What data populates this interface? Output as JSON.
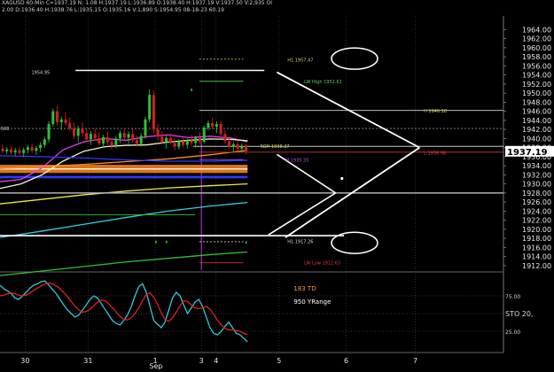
{
  "header": {
    "line1": "XAGUSD 60-Min  C=1937.19  N: 1.08  H:1937.19  L:1936.89  O:1938.40  H:1937.19  V:1937.50  V:2,935  OI",
    "line2": "2.00  D:1936.40  H:1938.76  L:1935.15  O:1935.16  V:1,890  S:1954.95  08-18-23 60.19"
  },
  "colors": {
    "background": "#000000",
    "price_box": "#ffffff",
    "up_candle": "#2fbf2f",
    "down_candle": "#d02020",
    "ma_magenta": "#e83cf0",
    "ma_white": "#f2f2d0",
    "ma_blue": "#2a3cff",
    "ma_orange": "#ff8a1c",
    "ma_yellow": "#f0e640",
    "ma_cyan": "#30d0e0",
    "ma_green": "#30c030",
    "stoch_cyan": "#30c8e0",
    "stoch_red": "#e02020"
  },
  "chart_data": [
    {
      "type": "candlestick",
      "yticks": [
        1912,
        1914,
        1916,
        1918,
        1920,
        1922,
        1924,
        1926,
        1928,
        1930,
        1932,
        1934,
        1936,
        1938,
        1940,
        1942,
        1944,
        1946,
        1948,
        1950,
        1952,
        1954,
        1956,
        1958,
        1960,
        1962,
        1964
      ],
      "ylim": [
        1911,
        1967
      ],
      "xlim": [
        0,
        120
      ],
      "date_labels": [
        {
          "label": "30",
          "x": 6
        },
        {
          "label": "31",
          "x": 21
        },
        {
          "label": "1",
          "x": 37
        },
        {
          "label": "Sep",
          "x": 37.2
        },
        {
          "label": "3",
          "x": 48
        },
        {
          "label": "4",
          "x": 51.5
        },
        {
          "label": "5",
          "x": 66.5
        },
        {
          "label": "6",
          "x": 82.5
        },
        {
          "label": "7",
          "x": 99
        }
      ],
      "current_price": "1937.19",
      "price_labels": [
        {
          "text": "1954.95",
          "x": 7.5,
          "y": 1954.6,
          "color": "#d8d8d8"
        },
        {
          "text": "500",
          "x": 0.2,
          "y": 1942.2,
          "color": "#d8d8d8"
        },
        {
          "text": "H1  1957.47",
          "x": 68.5,
          "y": 1957.3,
          "color": "#d8d060"
        },
        {
          "text": "LW High  1952.61",
          "x": 72.5,
          "y": 1952.6,
          "color": "#60d060"
        },
        {
          "text": "H  1946.18",
          "x": 101,
          "y": 1946.1,
          "color": "#d8d060"
        },
        {
          "text": "ROR  1938.27",
          "x": 62,
          "y": 1938.3,
          "color": "#d8d060"
        },
        {
          "text": "L  1936.98",
          "x": 101,
          "y": 1936.9,
          "color": "#e04040"
        },
        {
          "text": "M  1935.35",
          "x": 68,
          "y": 1935.3,
          "color": "#c050e0"
        },
        {
          "text": "H1  1917.26",
          "x": 68.5,
          "y": 1917.3,
          "color": "#d8d8d8"
        },
        {
          "text": "LW Low  1912.63",
          "x": 72.5,
          "y": 1912.7,
          "color": "#e04040"
        }
      ],
      "candles": [
        {
          "o": 1937.8,
          "h": 1938.6,
          "l": 1936.9,
          "c": 1937.2
        },
        {
          "o": 1937.2,
          "h": 1938.1,
          "l": 1936.6,
          "c": 1937.6
        },
        {
          "o": 1937.6,
          "h": 1938.4,
          "l": 1936.5,
          "c": 1936.9
        },
        {
          "o": 1936.9,
          "h": 1937.9,
          "l": 1936.2,
          "c": 1937.4
        },
        {
          "o": 1937.4,
          "h": 1938.2,
          "l": 1936.4,
          "c": 1936.8
        },
        {
          "o": 1936.8,
          "h": 1938.0,
          "l": 1935.9,
          "c": 1937.5
        },
        {
          "o": 1937.5,
          "h": 1938.6,
          "l": 1936.7,
          "c": 1938.1
        },
        {
          "o": 1938.1,
          "h": 1938.9,
          "l": 1936.8,
          "c": 1937.3
        },
        {
          "o": 1937.3,
          "h": 1938.4,
          "l": 1936.4,
          "c": 1937.9
        },
        {
          "o": 1937.9,
          "h": 1939.2,
          "l": 1937.0,
          "c": 1938.6
        },
        {
          "o": 1938.6,
          "h": 1940.4,
          "l": 1937.9,
          "c": 1939.8
        },
        {
          "o": 1939.8,
          "h": 1943.8,
          "l": 1939.1,
          "c": 1943.2
        },
        {
          "o": 1943.2,
          "h": 1946.6,
          "l": 1942.6,
          "c": 1946.0
        },
        {
          "o": 1946.0,
          "h": 1947.2,
          "l": 1942.8,
          "c": 1943.6
        },
        {
          "o": 1943.6,
          "h": 1944.8,
          "l": 1941.9,
          "c": 1944.2
        },
        {
          "o": 1944.2,
          "h": 1945.8,
          "l": 1942.9,
          "c": 1943.4
        },
        {
          "o": 1943.4,
          "h": 1944.6,
          "l": 1941.6,
          "c": 1942.2
        },
        {
          "o": 1942.2,
          "h": 1943.4,
          "l": 1939.9,
          "c": 1940.6
        },
        {
          "o": 1940.6,
          "h": 1942.8,
          "l": 1939.2,
          "c": 1942.2
        },
        {
          "o": 1942.2,
          "h": 1943.6,
          "l": 1940.4,
          "c": 1941.2
        },
        {
          "o": 1941.2,
          "h": 1942.4,
          "l": 1939.1,
          "c": 1939.8
        },
        {
          "o": 1939.8,
          "h": 1941.6,
          "l": 1938.6,
          "c": 1941.0
        },
        {
          "o": 1941.0,
          "h": 1942.2,
          "l": 1939.6,
          "c": 1940.1
        },
        {
          "o": 1940.1,
          "h": 1941.4,
          "l": 1938.4,
          "c": 1938.9
        },
        {
          "o": 1938.9,
          "h": 1940.8,
          "l": 1937.9,
          "c": 1940.3
        },
        {
          "o": 1940.3,
          "h": 1941.5,
          "l": 1938.6,
          "c": 1939.2
        },
        {
          "o": 1939.2,
          "h": 1940.1,
          "l": 1937.6,
          "c": 1938.4
        },
        {
          "o": 1938.4,
          "h": 1940.6,
          "l": 1937.9,
          "c": 1940.0
        },
        {
          "o": 1940.0,
          "h": 1941.8,
          "l": 1939.0,
          "c": 1941.2
        },
        {
          "o": 1941.2,
          "h": 1942.3,
          "l": 1939.6,
          "c": 1940.2
        },
        {
          "o": 1940.2,
          "h": 1941.6,
          "l": 1938.8,
          "c": 1941.0
        },
        {
          "o": 1941.0,
          "h": 1942.1,
          "l": 1939.1,
          "c": 1939.6
        },
        {
          "o": 1939.6,
          "h": 1940.6,
          "l": 1938.2,
          "c": 1938.8
        },
        {
          "o": 1938.8,
          "h": 1941.2,
          "l": 1938.2,
          "c": 1940.6
        },
        {
          "o": 1940.6,
          "h": 1944.8,
          "l": 1940.0,
          "c": 1944.2
        },
        {
          "o": 1944.2,
          "h": 1950.8,
          "l": 1943.6,
          "c": 1949.6
        },
        {
          "o": 1949.6,
          "h": 1950.6,
          "l": 1941.2,
          "c": 1942.0
        },
        {
          "o": 1942.0,
          "h": 1943.2,
          "l": 1939.6,
          "c": 1940.4
        },
        {
          "o": 1940.4,
          "h": 1941.6,
          "l": 1938.8,
          "c": 1939.2
        },
        {
          "o": 1939.2,
          "h": 1940.6,
          "l": 1937.8,
          "c": 1940.1
        },
        {
          "o": 1940.1,
          "h": 1941.2,
          "l": 1938.6,
          "c": 1939.0
        },
        {
          "o": 1939.0,
          "h": 1940.3,
          "l": 1937.4,
          "c": 1938.2
        },
        {
          "o": 1938.2,
          "h": 1939.8,
          "l": 1937.6,
          "c": 1939.4
        },
        {
          "o": 1939.4,
          "h": 1940.4,
          "l": 1938.1,
          "c": 1938.6
        },
        {
          "o": 1938.6,
          "h": 1940.0,
          "l": 1937.8,
          "c": 1939.6
        },
        {
          "o": 1939.6,
          "h": 1940.8,
          "l": 1938.4,
          "c": 1939.0
        },
        {
          "o": 1939.0,
          "h": 1940.6,
          "l": 1938.0,
          "c": 1940.2
        },
        {
          "o": 1940.2,
          "h": 1941.4,
          "l": 1938.8,
          "c": 1939.3
        },
        {
          "o": 1939.3,
          "h": 1942.8,
          "l": 1938.9,
          "c": 1942.4
        },
        {
          "o": 1942.4,
          "h": 1944.0,
          "l": 1941.8,
          "c": 1943.4
        },
        {
          "o": 1943.4,
          "h": 1944.6,
          "l": 1942.0,
          "c": 1942.6
        },
        {
          "o": 1942.6,
          "h": 1943.8,
          "l": 1941.2,
          "c": 1943.2
        },
        {
          "o": 1943.2,
          "h": 1943.9,
          "l": 1940.6,
          "c": 1941.0
        },
        {
          "o": 1941.0,
          "h": 1941.8,
          "l": 1938.8,
          "c": 1939.4
        },
        {
          "o": 1939.4,
          "h": 1940.4,
          "l": 1937.8,
          "c": 1938.2
        },
        {
          "o": 1938.2,
          "h": 1939.2,
          "l": 1937.0,
          "c": 1938.7
        },
        {
          "o": 1938.7,
          "h": 1939.4,
          "l": 1937.3,
          "c": 1937.8
        },
        {
          "o": 1937.8,
          "h": 1938.9,
          "l": 1937.0,
          "c": 1938.3
        },
        {
          "o": 1938.3,
          "h": 1938.8,
          "l": 1936.6,
          "c": 1937.2
        }
      ],
      "moving_averages": [
        {
          "color": "ma_magenta",
          "points": [
            [
              0,
              1930.5
            ],
            [
              5,
              1931
            ],
            [
              10,
              1933.5
            ],
            [
              15,
              1937.5
            ],
            [
              20,
              1939.3
            ],
            [
              25,
              1940
            ],
            [
              30,
              1939.6
            ],
            [
              35,
              1940.4
            ],
            [
              40,
              1940.8
            ],
            [
              45,
              1940.2
            ],
            [
              50,
              1940.5
            ],
            [
              55,
              1940.1
            ],
            [
              59,
              1939.3
            ]
          ]
        },
        {
          "color": "ma_white",
          "points": [
            [
              0,
              1929
            ],
            [
              5,
              1930
            ],
            [
              10,
              1932
            ],
            [
              15,
              1935
            ],
            [
              20,
              1937.2
            ],
            [
              25,
              1938.2
            ],
            [
              30,
              1938.5
            ],
            [
              35,
              1938.6
            ],
            [
              40,
              1939.2
            ],
            [
              45,
              1939.6
            ],
            [
              50,
              1939.9
            ],
            [
              55,
              1939.8
            ],
            [
              59,
              1939.5
            ]
          ]
        },
        {
          "color": "ma_orange",
          "points": [
            [
              0,
              1933.4
            ],
            [
              10,
              1933.8
            ],
            [
              20,
              1934.3
            ],
            [
              30,
              1934.9
            ],
            [
              40,
              1935.5
            ],
            [
              50,
              1936.4
            ],
            [
              59,
              1937.4
            ]
          ]
        },
        {
          "color": "ma_blue",
          "points": [
            [
              0,
              1936.2
            ],
            [
              10,
              1936.0
            ],
            [
              20,
              1935.7
            ],
            [
              30,
              1935.3
            ],
            [
              40,
              1935.0
            ],
            [
              50,
              1935.0
            ],
            [
              59,
              1935.2
            ]
          ]
        },
        {
          "color": "ma_yellow",
          "points": [
            [
              0,
              1925.6
            ],
            [
              10,
              1926.6
            ],
            [
              20,
              1927.6
            ],
            [
              30,
              1928.4
            ],
            [
              40,
              1929.1
            ],
            [
              50,
              1929.6
            ],
            [
              59,
              1930.0
            ]
          ]
        },
        {
          "color": "ma_cyan",
          "points": [
            [
              0,
              1918.2
            ],
            [
              10,
              1919.6
            ],
            [
              20,
              1921.1
            ],
            [
              30,
              1922.6
            ],
            [
              40,
              1924.0
            ],
            [
              50,
              1925.1
            ],
            [
              59,
              1925.9
            ]
          ]
        },
        {
          "color": "ma_green",
          "points": [
            [
              0,
              1909.8
            ],
            [
              10,
              1910.8
            ],
            [
              20,
              1911.8
            ],
            [
              30,
              1912.8
            ],
            [
              40,
              1913.6
            ],
            [
              50,
              1914.4
            ],
            [
              59,
              1915.0
            ]
          ]
        }
      ],
      "levels": [
        {
          "name": "H1 1957.47",
          "y": 1957.47,
          "x0": 47.5,
          "x1": 58,
          "color": "#d8c060",
          "dash": true
        },
        {
          "name": "Pivot top",
          "y": 1955.0,
          "x0": 18,
          "x1": 63,
          "color": "#ffffff",
          "dash": false
        },
        {
          "name": "LW High 1952.61",
          "y": 1952.61,
          "x0": 47.5,
          "x1": 58,
          "color": "#40c040",
          "dash": false
        },
        {
          "name": "H 1946.18",
          "y": 1946.18,
          "x0": 47.5,
          "x1": 120,
          "color": "#d8d8d8",
          "dash": false
        },
        {
          "name": "500",
          "y": 1942.2,
          "x0": 0,
          "x1": 120,
          "color": "#909090",
          "dash": true
        },
        {
          "name": "ROR 1938.27",
          "y": 1938.27,
          "x0": 46,
          "x1": 120,
          "color": "#c8c8c8",
          "dash": false
        },
        {
          "name": "L 1936.98",
          "y": 1936.98,
          "x0": 47.5,
          "x1": 120,
          "color": "#d03030",
          "dash": false
        },
        {
          "name": "M 1935.35",
          "y": 1935.35,
          "x0": 47.5,
          "x1": 58,
          "color": "#b040e0",
          "dash": false
        },
        {
          "name": "Pivot low",
          "y": 1928.0,
          "x0": 0,
          "x1": 120,
          "color": "#b0b0b0",
          "dash": false
        },
        {
          "name": "green level",
          "y": 1923.2,
          "x0": 0,
          "x1": 46.5,
          "color": "#30c030",
          "dash": false
        },
        {
          "name": "Pivot bottom",
          "y": 1918.6,
          "x0": 0,
          "x1": 82,
          "color": "#ffffff",
          "dash": false
        },
        {
          "name": "H1 1917.26",
          "y": 1917.26,
          "x0": 47.5,
          "x1": 58,
          "color": "#d8d8d8",
          "dash": true
        },
        {
          "name": "LW Low 1912.63",
          "y": 1912.63,
          "x0": 47.5,
          "x1": 58,
          "color": "#d03030",
          "dash": false
        }
      ]
    },
    {
      "type": "line",
      "title": "STO",
      "annotations": [
        "183 TD",
        "950 YRange"
      ],
      "ylim": [
        0,
        100
      ],
      "yticks": [
        {
          "v": 75,
          "label": "75.00"
        },
        {
          "v": 50,
          "label": "STO  20,"
        },
        {
          "v": 25,
          "label": "25.00"
        }
      ],
      "series": [
        {
          "color": "stoch_cyan",
          "values": [
            90,
            85,
            82,
            78,
            72,
            70,
            75,
            80,
            86,
            90,
            92,
            95,
            96,
            90,
            84,
            78,
            70,
            62,
            55,
            50,
            45,
            48,
            55,
            62,
            70,
            75,
            72,
            64,
            56,
            48,
            40,
            36,
            34,
            40,
            48,
            60,
            75,
            88,
            92,
            80,
            60,
            40,
            35,
            30,
            38,
            55,
            72,
            80,
            75,
            62,
            50,
            58,
            66,
            70,
            60,
            45,
            30,
            22,
            20,
            25,
            32,
            38,
            30,
            22,
            20,
            15,
            10
          ]
        },
        {
          "color": "stoch_red",
          "values": [
            75,
            76,
            78,
            79,
            78,
            76,
            75,
            76,
            79,
            83,
            86,
            89,
            92,
            93,
            92,
            89,
            85,
            80,
            74,
            67,
            60,
            55,
            52,
            53,
            56,
            61,
            66,
            69,
            68,
            64,
            58,
            52,
            46,
            42,
            41,
            44,
            50,
            58,
            68,
            77,
            79,
            73,
            63,
            51,
            42,
            39,
            44,
            52,
            61,
            68,
            67,
            62,
            58,
            57,
            58,
            60,
            56,
            49,
            40,
            34,
            29,
            27,
            27,
            26,
            25,
            22,
            20
          ]
        }
      ]
    }
  ]
}
